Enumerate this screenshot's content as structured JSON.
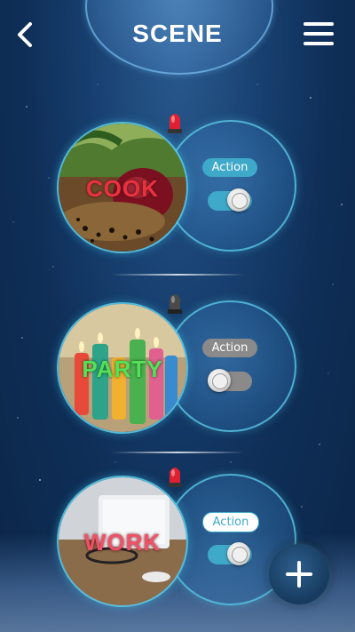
{
  "header": {
    "title": "SCENE"
  },
  "scenes": [
    {
      "name": "COOK",
      "action_label": "Action",
      "action_on": true,
      "alarm_active": true,
      "label_color": "#e8333f"
    },
    {
      "name": "PARTY",
      "action_label": "Action",
      "action_on": false,
      "alarm_active": false,
      "label_color": "#56e05a"
    },
    {
      "name": "WORK",
      "action_label": "Action",
      "action_on": true,
      "alarm_active": true,
      "label_color": "#f05266"
    }
  ],
  "colors": {
    "accent": "#3fa9c9",
    "toggle_on": "#3fa9c9",
    "toggle_off": "#8a8a8a",
    "alarm_on": "#e02030",
    "alarm_off": "#5a5a5a"
  },
  "icons": {
    "back": "chevron-left-icon",
    "menu": "hamburger-menu-icon",
    "alarm": "siren-icon",
    "add": "plus-icon"
  }
}
